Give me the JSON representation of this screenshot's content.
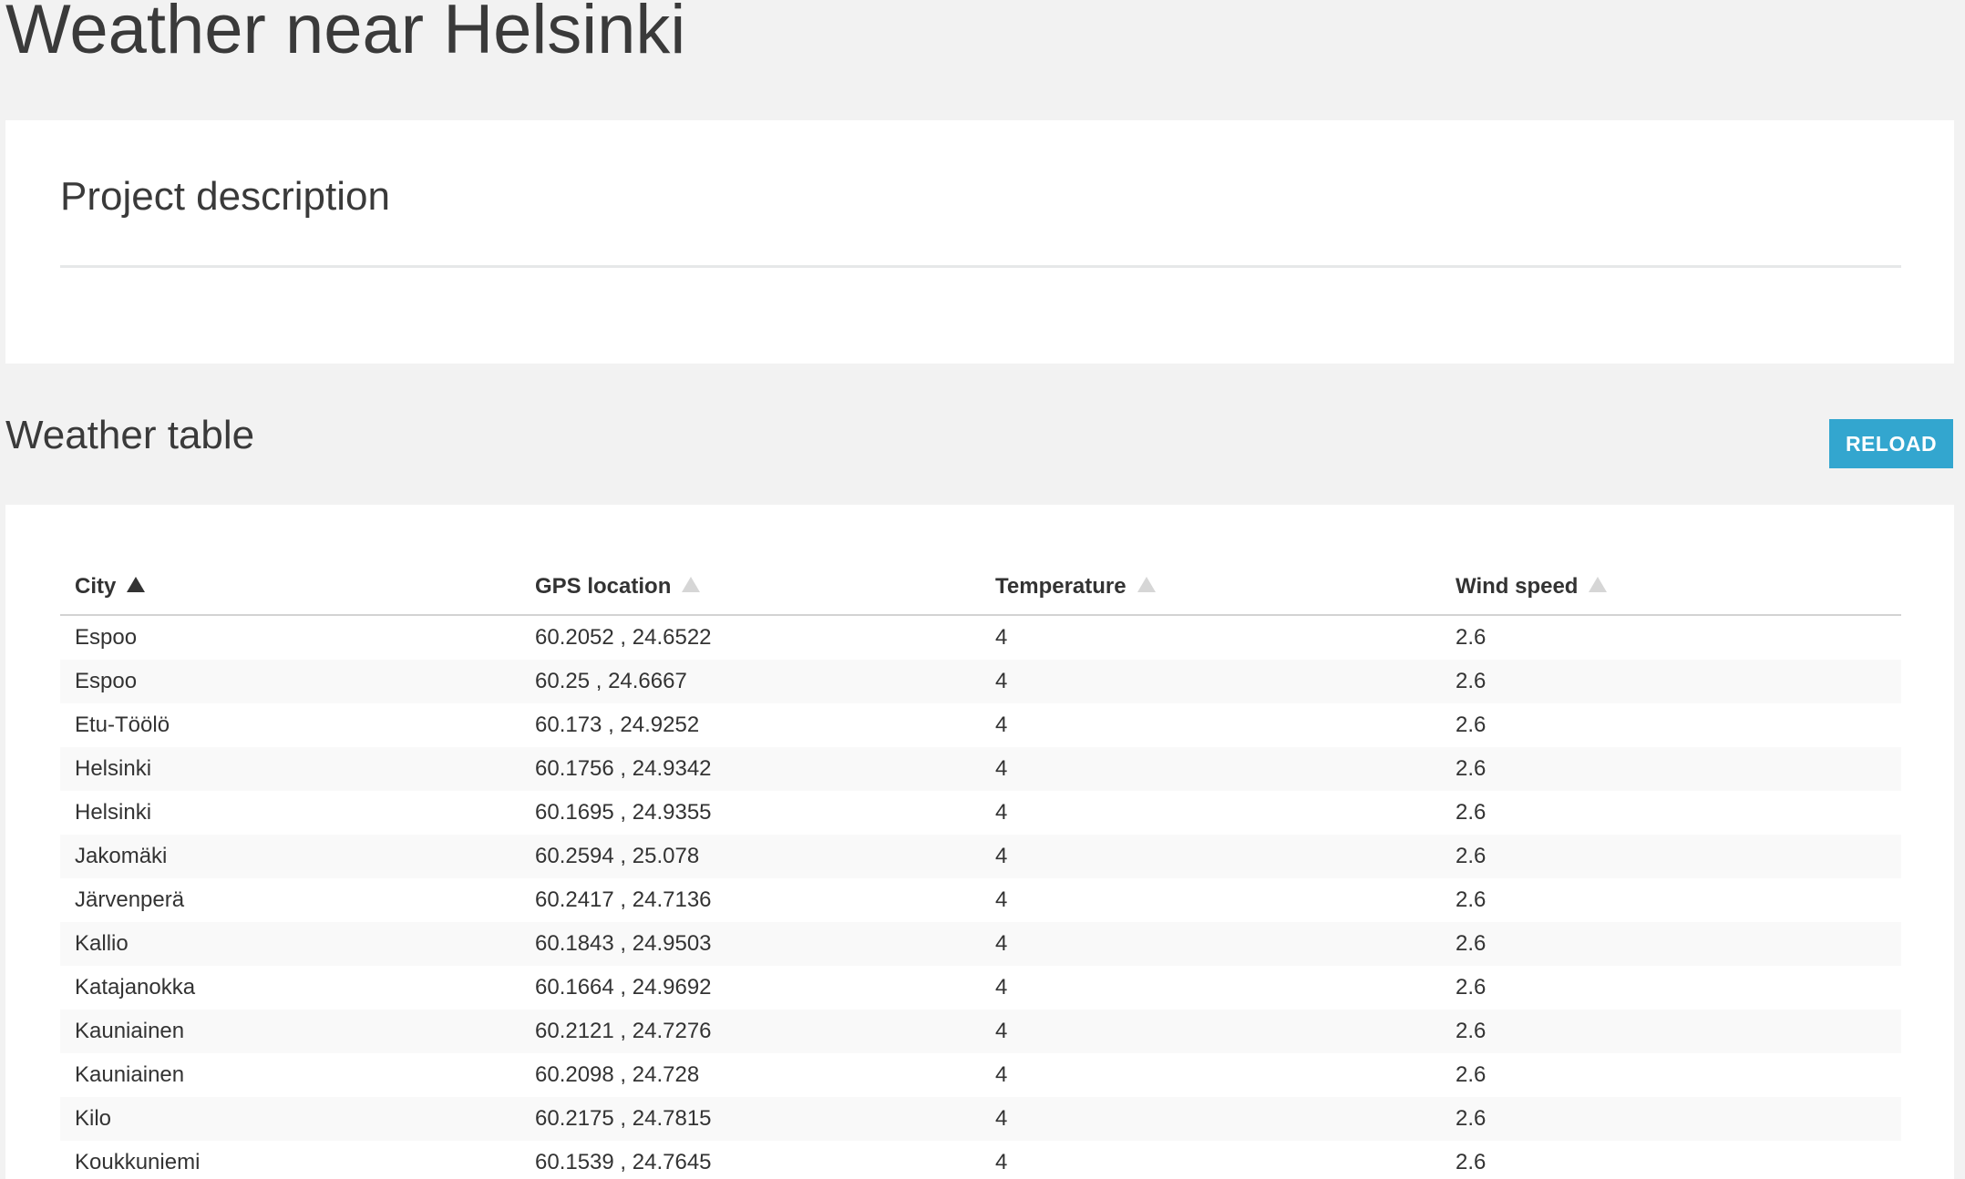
{
  "page": {
    "title": "Weather near Helsinki"
  },
  "description": {
    "title": "Project description"
  },
  "weather": {
    "title": "Weather table",
    "reload_label": "RELOAD",
    "accent_color": "#33a6cf",
    "columns": [
      {
        "label": "City",
        "sort": "asc",
        "sort_icon": "triangle-up-icon"
      },
      {
        "label": "GPS location",
        "sort": "none",
        "sort_icon": "triangle-up-icon"
      },
      {
        "label": "Temperature",
        "sort": "none",
        "sort_icon": "triangle-up-icon"
      },
      {
        "label": "Wind speed",
        "sort": "none",
        "sort_icon": "triangle-up-icon"
      }
    ],
    "rows": [
      {
        "city": "Espoo",
        "gps": "60.2052 , 24.6522",
        "temperature": "4",
        "wind": "2.6"
      },
      {
        "city": "Espoo",
        "gps": "60.25 , 24.6667",
        "temperature": "4",
        "wind": "2.6"
      },
      {
        "city": "Etu-Töölö",
        "gps": "60.173 , 24.9252",
        "temperature": "4",
        "wind": "2.6"
      },
      {
        "city": "Helsinki",
        "gps": "60.1756 , 24.9342",
        "temperature": "4",
        "wind": "2.6"
      },
      {
        "city": "Helsinki",
        "gps": "60.1695 , 24.9355",
        "temperature": "4",
        "wind": "2.6"
      },
      {
        "city": "Jakomäki",
        "gps": "60.2594 , 25.078",
        "temperature": "4",
        "wind": "2.6"
      },
      {
        "city": "Järvenperä",
        "gps": "60.2417 , 24.7136",
        "temperature": "4",
        "wind": "2.6"
      },
      {
        "city": "Kallio",
        "gps": "60.1843 , 24.9503",
        "temperature": "4",
        "wind": "2.6"
      },
      {
        "city": "Katajanokka",
        "gps": "60.1664 , 24.9692",
        "temperature": "4",
        "wind": "2.6"
      },
      {
        "city": "Kauniainen",
        "gps": "60.2121 , 24.7276",
        "temperature": "4",
        "wind": "2.6"
      },
      {
        "city": "Kauniainen",
        "gps": "60.2098 , 24.728",
        "temperature": "4",
        "wind": "2.6"
      },
      {
        "city": "Kilo",
        "gps": "60.2175 , 24.7815",
        "temperature": "4",
        "wind": "2.6"
      },
      {
        "city": "Koukkuniemi",
        "gps": "60.1539 , 24.7645",
        "temperature": "4",
        "wind": "2.6"
      }
    ]
  }
}
